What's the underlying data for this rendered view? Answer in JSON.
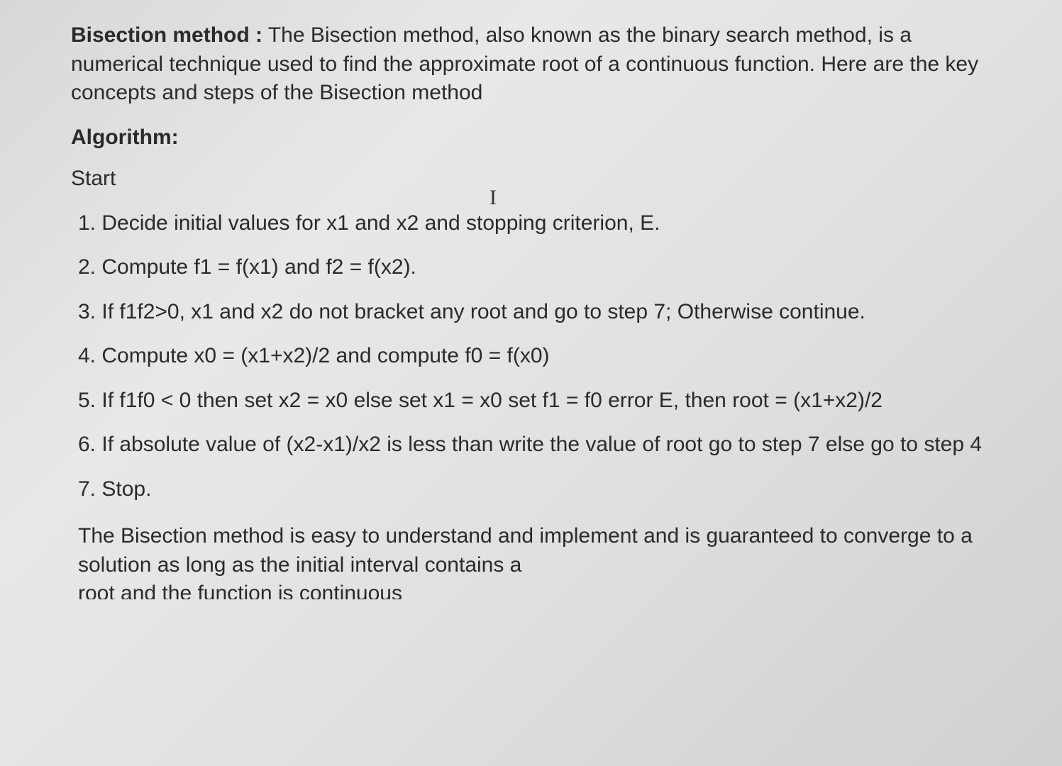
{
  "intro": {
    "title": "Bisection method :",
    "description": " The Bisection method, also known as the binary search method, is a numerical technique used to find the approximate root of a continuous function. Here are the key concepts and steps of the Bisection method"
  },
  "algorithm_label": "Algorithm:",
  "start_label": "Start",
  "steps": {
    "s1": "1. Decide initial values for x1 and x2 and stopping criterion, E.",
    "s2": "2. Compute f1 = f(x1) and f2 = f(x2).",
    "s3": "3. If f1f2>0, x1 and x2 do not bracket any root and go to step 7; Otherwise continue.",
    "s4": "4. Compute x0 = (x1+x2)/2 and compute f0 = f(x0)",
    "s5": "5. If f1f0 < 0 then set x2 = x0 else set x1 = x0 set f1 = f0 error E, then root = (x1+x2)/2",
    "s6": "6. If absolute value of (x2-x1)/x2 is less than write the value of root go to step 7 else go to step 4",
    "s7": "7. Stop."
  },
  "conclusion": {
    "line1": "The Bisection method is easy to understand and implement and is guaranteed to converge to a solution as long as the initial interval contains a",
    "line2": "root and the function is continuous"
  }
}
